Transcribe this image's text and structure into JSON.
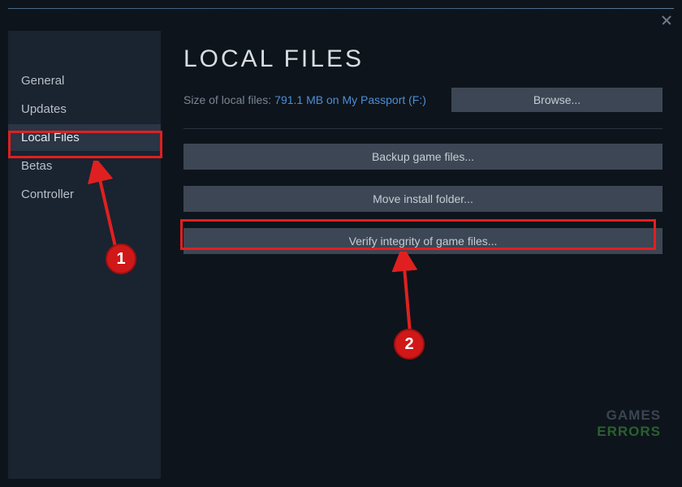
{
  "sidebar": {
    "items": [
      {
        "label": "General"
      },
      {
        "label": "Updates"
      },
      {
        "label": "Local Files"
      },
      {
        "label": "Betas"
      },
      {
        "label": "Controller"
      }
    ]
  },
  "main": {
    "title": "LOCAL FILES",
    "size_label": "Size of local files:",
    "size_value": "791.1 MB on My Passport (F:)",
    "browse_label": "Browse...",
    "backup_label": "Backup game files...",
    "move_label": "Move install folder...",
    "verify_label": "Verify integrity of game files..."
  },
  "annotations": {
    "badge1": "1",
    "badge2": "2"
  },
  "watermark": {
    "line1": "GAMES",
    "line2": "ERRORS"
  }
}
